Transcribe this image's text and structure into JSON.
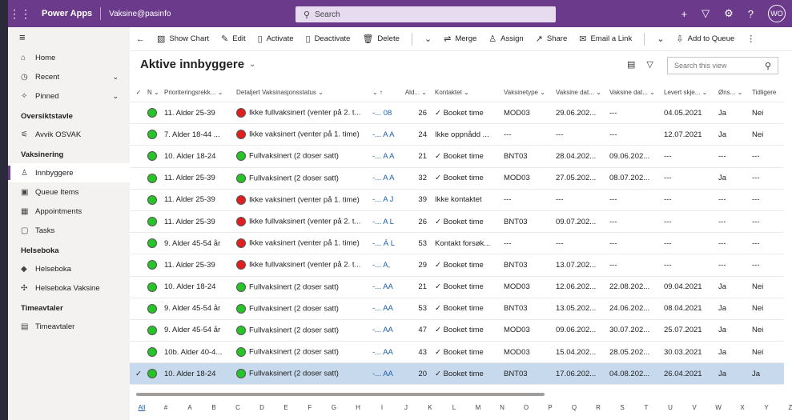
{
  "topbar": {
    "app_name": "Power Apps",
    "environment": "Vaksine@pasinfo",
    "search_placeholder": "Search",
    "avatar": "WO"
  },
  "sidebar": {
    "home": "Home",
    "recent": "Recent",
    "pinned": "Pinned",
    "groups": [
      {
        "title": "Oversiktstavle",
        "items": [
          "Avvik OSVAK"
        ]
      },
      {
        "title": "Vaksinering",
        "items": [
          "Innbyggere",
          "Queue Items",
          "Appointments",
          "Tasks"
        ]
      },
      {
        "title": "Helseboka",
        "items": [
          "Helseboka",
          "Helseboka Vaksine"
        ]
      },
      {
        "title": "Timeavtaler",
        "items": [
          "Timeavtaler"
        ]
      }
    ],
    "selected": "Innbyggere"
  },
  "commands": [
    "Show Chart",
    "Edit",
    "Activate",
    "Deactivate",
    "Delete",
    "Merge",
    "Assign",
    "Share",
    "Email a Link",
    "Add to Queue"
  ],
  "view": {
    "title": "Aktive innbyggere",
    "search_placeholder": "Search this view"
  },
  "columns": [
    "N",
    "Prioriteringsrekk...",
    "Detaljert Vaksinasjonsstatus",
    "",
    "Ald...",
    "Kontaktet",
    "Vaksinetype",
    "Vaksine dat...",
    "Vaksine dat...",
    "Levert skje...",
    "Øns...",
    "Tidligere"
  ],
  "rows": [
    {
      "status": "g",
      "pri": "11. Alder 25-39",
      "sd": "r",
      "detail": "Ikke fullvaksinert (venter på 2. t...",
      "name": "08",
      "age": "26",
      "contact": "✓ Booket time",
      "vtype": "MOD03",
      "d1": "29.06.202...",
      "d2": "---",
      "lev": "04.05.2021",
      "ons": "Ja",
      "tid": "Nei"
    },
    {
      "status": "g",
      "pri": "7. Alder 18-44 ...",
      "sd": "r",
      "detail": "Ikke vaksinert (venter på 1. time)",
      "name": "A A",
      "age": "24",
      "contact": "Ikke oppnådd ...",
      "vtype": "---",
      "d1": "---",
      "d2": "---",
      "lev": "12.07.2021",
      "ons": "Ja",
      "tid": "Nei"
    },
    {
      "status": "g",
      "pri": "10. Alder 18-24",
      "sd": "g",
      "detail": "Fullvaksinert (2 doser satt)",
      "name": "A A",
      "age": "21",
      "contact": "✓ Booket time",
      "vtype": "BNT03",
      "d1": "28.04.202...",
      "d2": "09.06.202...",
      "lev": "---",
      "ons": "---",
      "tid": "---"
    },
    {
      "status": "g",
      "pri": "11. Alder 25-39",
      "sd": "g",
      "detail": "Fullvaksinert (2 doser satt)",
      "name": "A A",
      "age": "32",
      "contact": "✓ Booket time",
      "vtype": "MOD03",
      "d1": "27.05.202...",
      "d2": "08.07.202...",
      "lev": "---",
      "ons": "Ja",
      "tid": "---"
    },
    {
      "status": "g",
      "pri": "11. Alder 25-39",
      "sd": "r",
      "detail": "Ikke vaksinert (venter på 1. time)",
      "name": "A J",
      "age": "39",
      "contact": "Ikke kontaktet",
      "vtype": "---",
      "d1": "---",
      "d2": "---",
      "lev": "---",
      "ons": "---",
      "tid": "---"
    },
    {
      "status": "g",
      "pri": "11. Alder 25-39",
      "sd": "r",
      "detail": "Ikke fullvaksinert (venter på 2. t...",
      "name": "A L",
      "age": "26",
      "contact": "✓ Booket time",
      "vtype": "BNT03",
      "d1": "09.07.202...",
      "d2": "---",
      "lev": "---",
      "ons": "---",
      "tid": "---"
    },
    {
      "status": "g",
      "pri": "9. Alder 45-54 år",
      "sd": "r",
      "detail": "Ikke vaksinert (venter på 1. time)",
      "name": "Á L",
      "age": "53",
      "contact": "Kontakt forsøk...",
      "vtype": "---",
      "d1": "---",
      "d2": "---",
      "lev": "---",
      "ons": "---",
      "tid": "---"
    },
    {
      "status": "g",
      "pri": "11. Alder 25-39",
      "sd": "r",
      "detail": "Ikke fullvaksinert (venter på 2. t...",
      "name": "A,",
      "age": "29",
      "contact": "✓ Booket time",
      "vtype": "BNT03",
      "d1": "13.07.202...",
      "d2": "---",
      "lev": "---",
      "ons": "---",
      "tid": "---"
    },
    {
      "status": "g",
      "pri": "10. Alder 18-24",
      "sd": "g",
      "detail": "Fullvaksinert (2 doser satt)",
      "name": "AA",
      "age": "21",
      "contact": "✓ Booket time",
      "vtype": "MOD03",
      "d1": "12.06.202...",
      "d2": "22.08.202...",
      "lev": "09.04.2021",
      "ons": "Ja",
      "tid": "Nei"
    },
    {
      "status": "g",
      "pri": "9. Alder 45-54 år",
      "sd": "g",
      "detail": "Fullvaksinert (2 doser satt)",
      "name": "AA",
      "age": "53",
      "contact": "✓ Booket time",
      "vtype": "BNT03",
      "d1": "13.05.202...",
      "d2": "24.06.202...",
      "lev": "08.04.2021",
      "ons": "Ja",
      "tid": "Nei"
    },
    {
      "status": "g",
      "pri": "9. Alder 45-54 år",
      "sd": "g",
      "detail": "Fullvaksinert (2 doser satt)",
      "name": "AA",
      "age": "47",
      "contact": "✓ Booket time",
      "vtype": "MOD03",
      "d1": "09.06.202...",
      "d2": "30.07.202...",
      "lev": "25.07.2021",
      "ons": "Ja",
      "tid": "Nei"
    },
    {
      "status": "g",
      "pri": "10b. Alder 40-4...",
      "sd": "g",
      "detail": "Fullvaksinert (2 doser satt)",
      "name": "AA",
      "age": "43",
      "contact": "✓ Booket time",
      "vtype": "MOD03",
      "d1": "15.04.202...",
      "d2": "28.05.202...",
      "lev": "30.03.2021",
      "ons": "Ja",
      "tid": "Nei"
    },
    {
      "status": "g",
      "pri": "10. Alder 18-24",
      "sd": "g",
      "detail": "Fullvaksinert (2 doser satt)",
      "name": "AA",
      "age": "20",
      "contact": "✓ Booket time",
      "vtype": "BNT03",
      "d1": "17.06.202...",
      "d2": "04.08.202...",
      "lev": "26.04.2021",
      "ons": "Ja",
      "tid": "Ja",
      "selected": true
    }
  ],
  "jumpbar": [
    "All",
    "#",
    "A",
    "B",
    "C",
    "D",
    "E",
    "F",
    "G",
    "H",
    "I",
    "J",
    "K",
    "L",
    "M",
    "N",
    "O",
    "P",
    "Q",
    "R",
    "S",
    "T",
    "U",
    "V",
    "W",
    "X",
    "Y",
    "Z"
  ]
}
